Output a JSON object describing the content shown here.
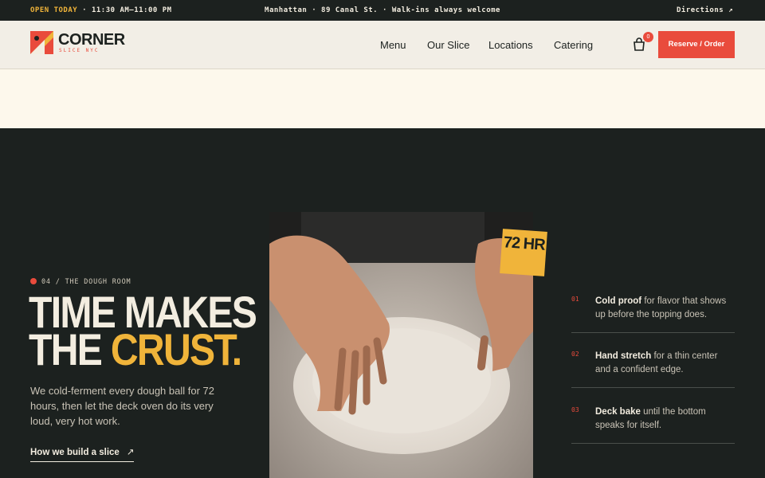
{
  "topbar": {
    "open_label": "OPEN TODAY",
    "hours": "· 11:30 AM–11:00 PM",
    "address": "Manhattan · 89 Canal St. · Walk-ins always welcome",
    "directions": "Directions ↗"
  },
  "brand": {
    "name": "CORNER",
    "sub": "SLICE NYC"
  },
  "nav": [
    "Menu",
    "Our Slice",
    "Locations",
    "Catering"
  ],
  "cart": {
    "count": "0"
  },
  "cta": "Reserve / Order",
  "section": {
    "eyebrow": "04 / THE DOUGH ROOM",
    "headline_line1": "TIME MAKES",
    "headline_line2a": "THE ",
    "headline_line2b": "CRUST.",
    "lede": "We cold-ferment every dough ball for 72 hours, then let the deck oven do its very loud, very hot work.",
    "link": "How we build a slice",
    "badge": "72 HR"
  },
  "steps": [
    {
      "num": "01",
      "bold": "Cold proof",
      "rest": " for flavor that shows up before the topping does."
    },
    {
      "num": "02",
      "bold": "Hand stretch",
      "rest": " for a thin center and a confident edge."
    },
    {
      "num": "03",
      "bold": "Deck bake",
      "rest": " until the bottom speaks for itself."
    }
  ],
  "colors": {
    "accent_red": "#e94b3c",
    "accent_yellow": "#f0b43a",
    "dark": "#1c211f",
    "cream": "#fdf8ec"
  }
}
